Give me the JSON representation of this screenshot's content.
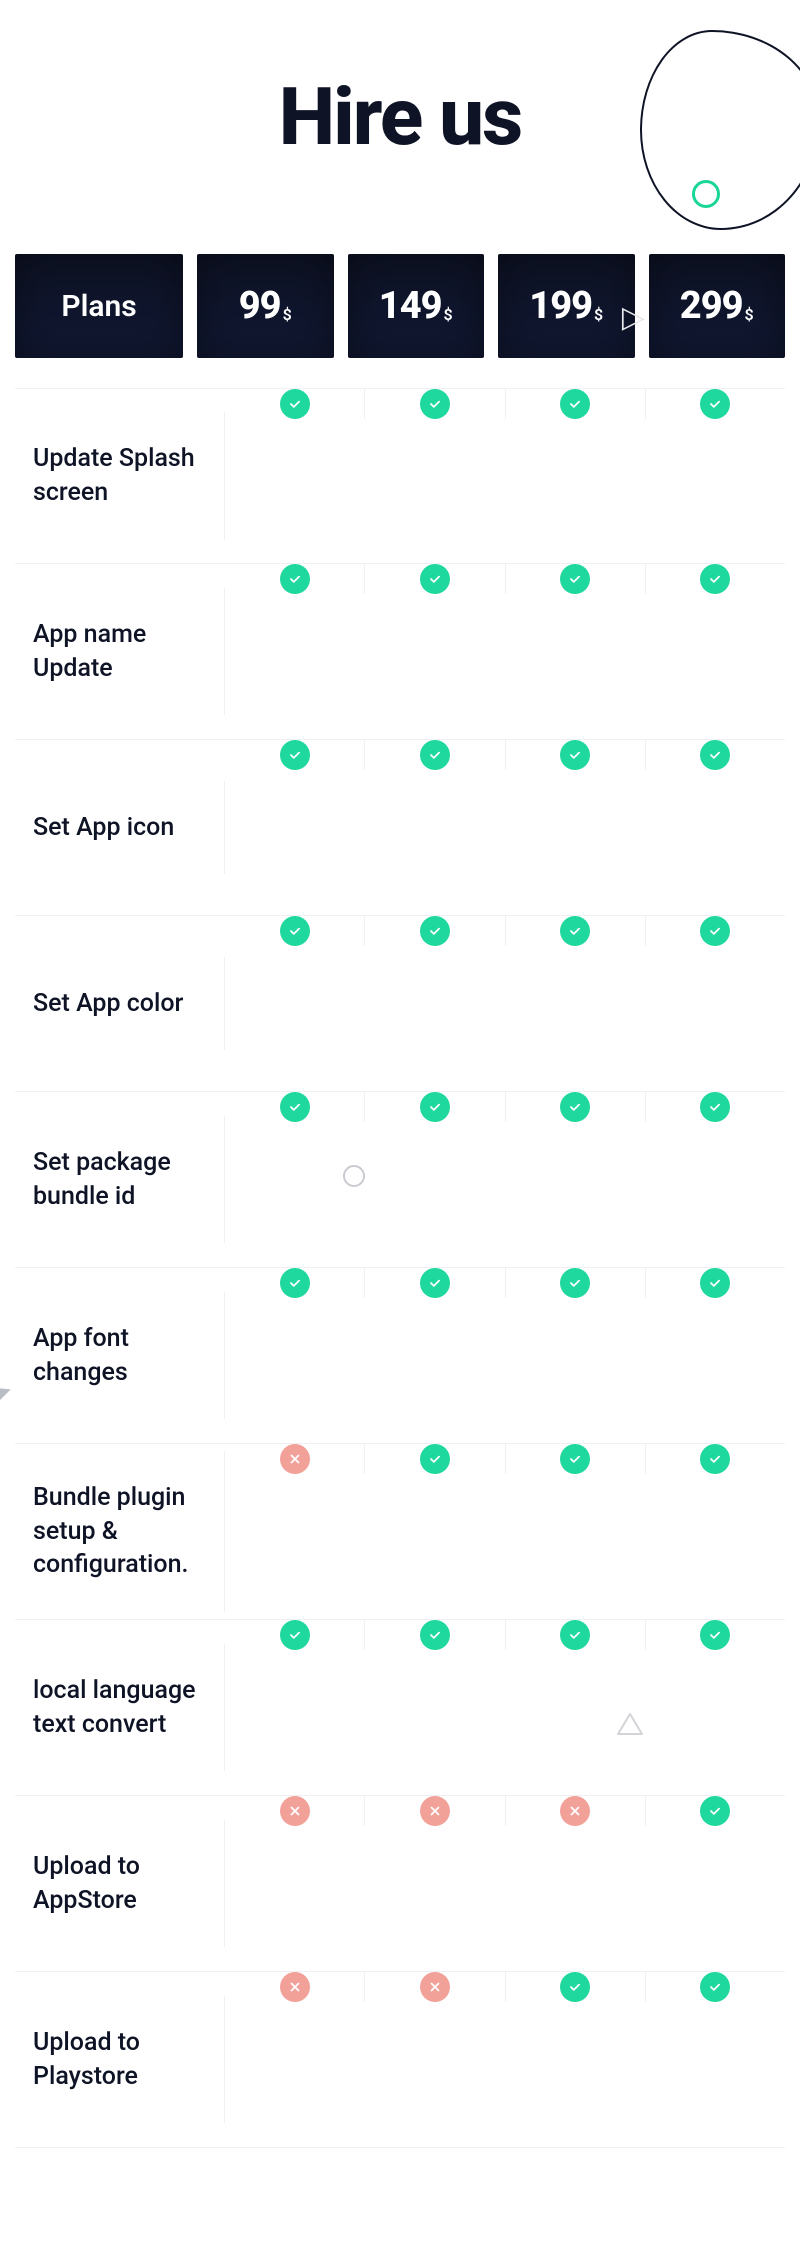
{
  "title": "Hire us",
  "plansLabel": "Plans",
  "currency": "$",
  "prices": [
    "99",
    "149",
    "199",
    "299"
  ],
  "features": [
    {
      "label": "Update Splash screen",
      "values": [
        true,
        true,
        true,
        true
      ]
    },
    {
      "label": "App name Update",
      "values": [
        true,
        true,
        true,
        true
      ]
    },
    {
      "label": "Set App icon",
      "values": [
        true,
        true,
        true,
        true
      ]
    },
    {
      "label": "Set App color",
      "values": [
        true,
        true,
        true,
        true
      ]
    },
    {
      "label": "Set package bundle id",
      "values": [
        true,
        true,
        true,
        true
      ]
    },
    {
      "label": "App font changes",
      "values": [
        true,
        true,
        true,
        true
      ]
    },
    {
      "label": "Bundle plugin setup & configuration.",
      "values": [
        false,
        true,
        true,
        true
      ]
    },
    {
      "label": "local language text convert",
      "values": [
        true,
        true,
        true,
        true
      ]
    },
    {
      "label": "Upload to AppStore",
      "values": [
        false,
        false,
        false,
        true
      ]
    },
    {
      "label": "Upload to Playstore",
      "values": [
        false,
        false,
        true,
        true
      ]
    }
  ]
}
